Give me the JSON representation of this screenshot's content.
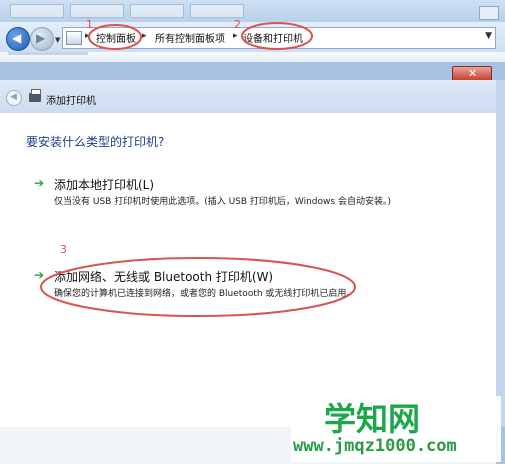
{
  "breadcrumb": {
    "item1": "控制面板",
    "item2": "所有控制面板项",
    "item3": "设备和打印机"
  },
  "annotations": {
    "n1": "1",
    "n2": "2",
    "n3": "3"
  },
  "dialog": {
    "title": "添加打印机",
    "question": "要安装什么类型的打印机?",
    "option_local": {
      "title": "添加本地打印机(L)",
      "desc": "仅当没有 USB 打印机时使用此选项。(插入 USB 打印机后，Windows 会自动安装。)"
    },
    "option_network": {
      "title": "添加网络、无线或 Bluetooth 打印机(W)",
      "desc": "确保您的计算机已连接到网络，或者您的 Bluetooth 或无线打印机已启用。"
    }
  },
  "watermark": {
    "logo": "学知网",
    "url": "www.jmqz1000.com"
  },
  "colors": {
    "annotation": "#d9534f",
    "question": "#1c3f8c",
    "arrow": "#2e9e3f",
    "watermark": "#1aa84a"
  },
  "icons": [
    "back-icon",
    "forward-icon",
    "folder-icon",
    "printer-icon",
    "close-icon",
    "green-arrow-icon"
  ]
}
